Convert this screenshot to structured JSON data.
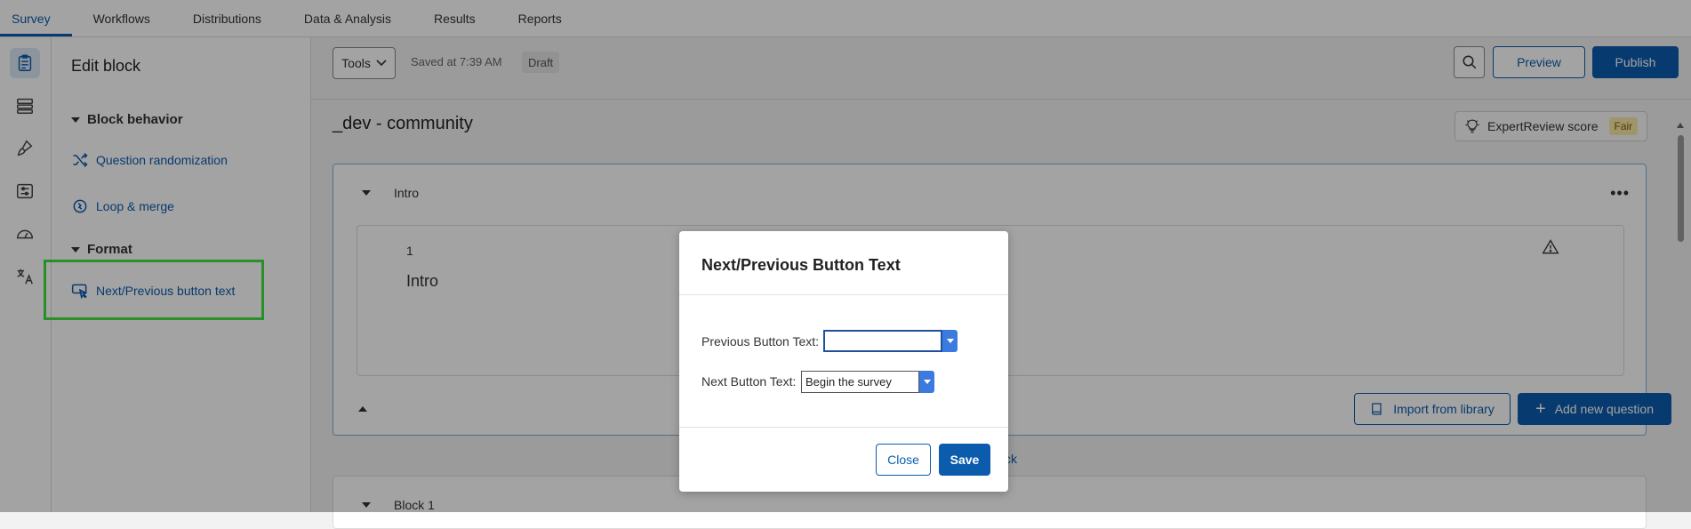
{
  "top_nav": {
    "tabs": [
      {
        "label": "Survey",
        "active": true
      },
      {
        "label": "Workflows"
      },
      {
        "label": "Distributions"
      },
      {
        "label": "Data & Analysis"
      },
      {
        "label": "Results"
      },
      {
        "label": "Reports"
      }
    ]
  },
  "left_rail": {
    "icons": [
      "survey-icon",
      "flow-icon",
      "look-and-feel-icon",
      "survey-options-icon",
      "tools-gauge-icon",
      "translate-icon"
    ]
  },
  "side_panel": {
    "title": "Edit block",
    "sections": [
      {
        "heading": "Block behavior",
        "links": [
          "Question randomization",
          "Loop & merge"
        ]
      },
      {
        "heading": "Format",
        "links": [
          "Next/Previous button text"
        ]
      }
    ]
  },
  "toolbar": {
    "tools_label": "Tools",
    "saved_text": "Saved at 7:39 AM",
    "draft_label": "Draft",
    "preview_label": "Preview",
    "publish_label": "Publish"
  },
  "survey": {
    "title": "_dev - community",
    "expert_review_label": "ExpertReview score",
    "expert_review_score": "Fair",
    "blocks": [
      {
        "name": "Intro",
        "question_number": "1",
        "question_text": "Intro",
        "import_label": "Import from library",
        "add_question_label": "Add new question"
      },
      {
        "name": "Block 1"
      }
    ],
    "add_block_partial": "ck"
  },
  "modal": {
    "title": "Next/Previous Button Text",
    "previous_label": "Previous Button Text:",
    "previous_value": "",
    "next_label": "Next Button Text:",
    "next_value": "Begin the survey",
    "close_label": "Close",
    "save_label": "Save"
  },
  "colors": {
    "accent": "#0b5cad",
    "highlight": "#3fe13f",
    "badge_fair": "#fbe9a6"
  }
}
